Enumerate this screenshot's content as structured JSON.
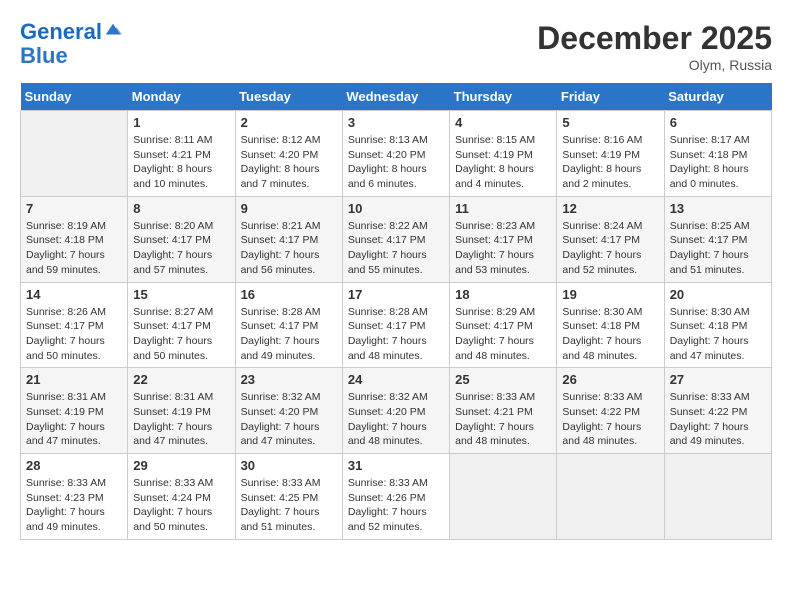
{
  "header": {
    "logo_line1": "General",
    "logo_line2": "Blue",
    "month": "December 2025",
    "location": "Olym, Russia"
  },
  "days_of_week": [
    "Sunday",
    "Monday",
    "Tuesday",
    "Wednesday",
    "Thursday",
    "Friday",
    "Saturday"
  ],
  "weeks": [
    [
      {
        "day": "",
        "info": ""
      },
      {
        "day": "1",
        "info": "Sunrise: 8:11 AM\nSunset: 4:21 PM\nDaylight: 8 hours\nand 10 minutes."
      },
      {
        "day": "2",
        "info": "Sunrise: 8:12 AM\nSunset: 4:20 PM\nDaylight: 8 hours\nand 7 minutes."
      },
      {
        "day": "3",
        "info": "Sunrise: 8:13 AM\nSunset: 4:20 PM\nDaylight: 8 hours\nand 6 minutes."
      },
      {
        "day": "4",
        "info": "Sunrise: 8:15 AM\nSunset: 4:19 PM\nDaylight: 8 hours\nand 4 minutes."
      },
      {
        "day": "5",
        "info": "Sunrise: 8:16 AM\nSunset: 4:19 PM\nDaylight: 8 hours\nand 2 minutes."
      },
      {
        "day": "6",
        "info": "Sunrise: 8:17 AM\nSunset: 4:18 PM\nDaylight: 8 hours\nand 0 minutes."
      }
    ],
    [
      {
        "day": "7",
        "info": "Sunrise: 8:19 AM\nSunset: 4:18 PM\nDaylight: 7 hours\nand 59 minutes."
      },
      {
        "day": "8",
        "info": "Sunrise: 8:20 AM\nSunset: 4:17 PM\nDaylight: 7 hours\nand 57 minutes."
      },
      {
        "day": "9",
        "info": "Sunrise: 8:21 AM\nSunset: 4:17 PM\nDaylight: 7 hours\nand 56 minutes."
      },
      {
        "day": "10",
        "info": "Sunrise: 8:22 AM\nSunset: 4:17 PM\nDaylight: 7 hours\nand 55 minutes."
      },
      {
        "day": "11",
        "info": "Sunrise: 8:23 AM\nSunset: 4:17 PM\nDaylight: 7 hours\nand 53 minutes."
      },
      {
        "day": "12",
        "info": "Sunrise: 8:24 AM\nSunset: 4:17 PM\nDaylight: 7 hours\nand 52 minutes."
      },
      {
        "day": "13",
        "info": "Sunrise: 8:25 AM\nSunset: 4:17 PM\nDaylight: 7 hours\nand 51 minutes."
      }
    ],
    [
      {
        "day": "14",
        "info": "Sunrise: 8:26 AM\nSunset: 4:17 PM\nDaylight: 7 hours\nand 50 minutes."
      },
      {
        "day": "15",
        "info": "Sunrise: 8:27 AM\nSunset: 4:17 PM\nDaylight: 7 hours\nand 50 minutes."
      },
      {
        "day": "16",
        "info": "Sunrise: 8:28 AM\nSunset: 4:17 PM\nDaylight: 7 hours\nand 49 minutes."
      },
      {
        "day": "17",
        "info": "Sunrise: 8:28 AM\nSunset: 4:17 PM\nDaylight: 7 hours\nand 48 minutes."
      },
      {
        "day": "18",
        "info": "Sunrise: 8:29 AM\nSunset: 4:17 PM\nDaylight: 7 hours\nand 48 minutes."
      },
      {
        "day": "19",
        "info": "Sunrise: 8:30 AM\nSunset: 4:18 PM\nDaylight: 7 hours\nand 48 minutes."
      },
      {
        "day": "20",
        "info": "Sunrise: 8:30 AM\nSunset: 4:18 PM\nDaylight: 7 hours\nand 47 minutes."
      }
    ],
    [
      {
        "day": "21",
        "info": "Sunrise: 8:31 AM\nSunset: 4:19 PM\nDaylight: 7 hours\nand 47 minutes."
      },
      {
        "day": "22",
        "info": "Sunrise: 8:31 AM\nSunset: 4:19 PM\nDaylight: 7 hours\nand 47 minutes."
      },
      {
        "day": "23",
        "info": "Sunrise: 8:32 AM\nSunset: 4:20 PM\nDaylight: 7 hours\nand 47 minutes."
      },
      {
        "day": "24",
        "info": "Sunrise: 8:32 AM\nSunset: 4:20 PM\nDaylight: 7 hours\nand 48 minutes."
      },
      {
        "day": "25",
        "info": "Sunrise: 8:33 AM\nSunset: 4:21 PM\nDaylight: 7 hours\nand 48 minutes."
      },
      {
        "day": "26",
        "info": "Sunrise: 8:33 AM\nSunset: 4:22 PM\nDaylight: 7 hours\nand 48 minutes."
      },
      {
        "day": "27",
        "info": "Sunrise: 8:33 AM\nSunset: 4:22 PM\nDaylight: 7 hours\nand 49 minutes."
      }
    ],
    [
      {
        "day": "28",
        "info": "Sunrise: 8:33 AM\nSunset: 4:23 PM\nDaylight: 7 hours\nand 49 minutes."
      },
      {
        "day": "29",
        "info": "Sunrise: 8:33 AM\nSunset: 4:24 PM\nDaylight: 7 hours\nand 50 minutes."
      },
      {
        "day": "30",
        "info": "Sunrise: 8:33 AM\nSunset: 4:25 PM\nDaylight: 7 hours\nand 51 minutes."
      },
      {
        "day": "31",
        "info": "Sunrise: 8:33 AM\nSunset: 4:26 PM\nDaylight: 7 hours\nand 52 minutes."
      },
      {
        "day": "",
        "info": ""
      },
      {
        "day": "",
        "info": ""
      },
      {
        "day": "",
        "info": ""
      }
    ]
  ]
}
